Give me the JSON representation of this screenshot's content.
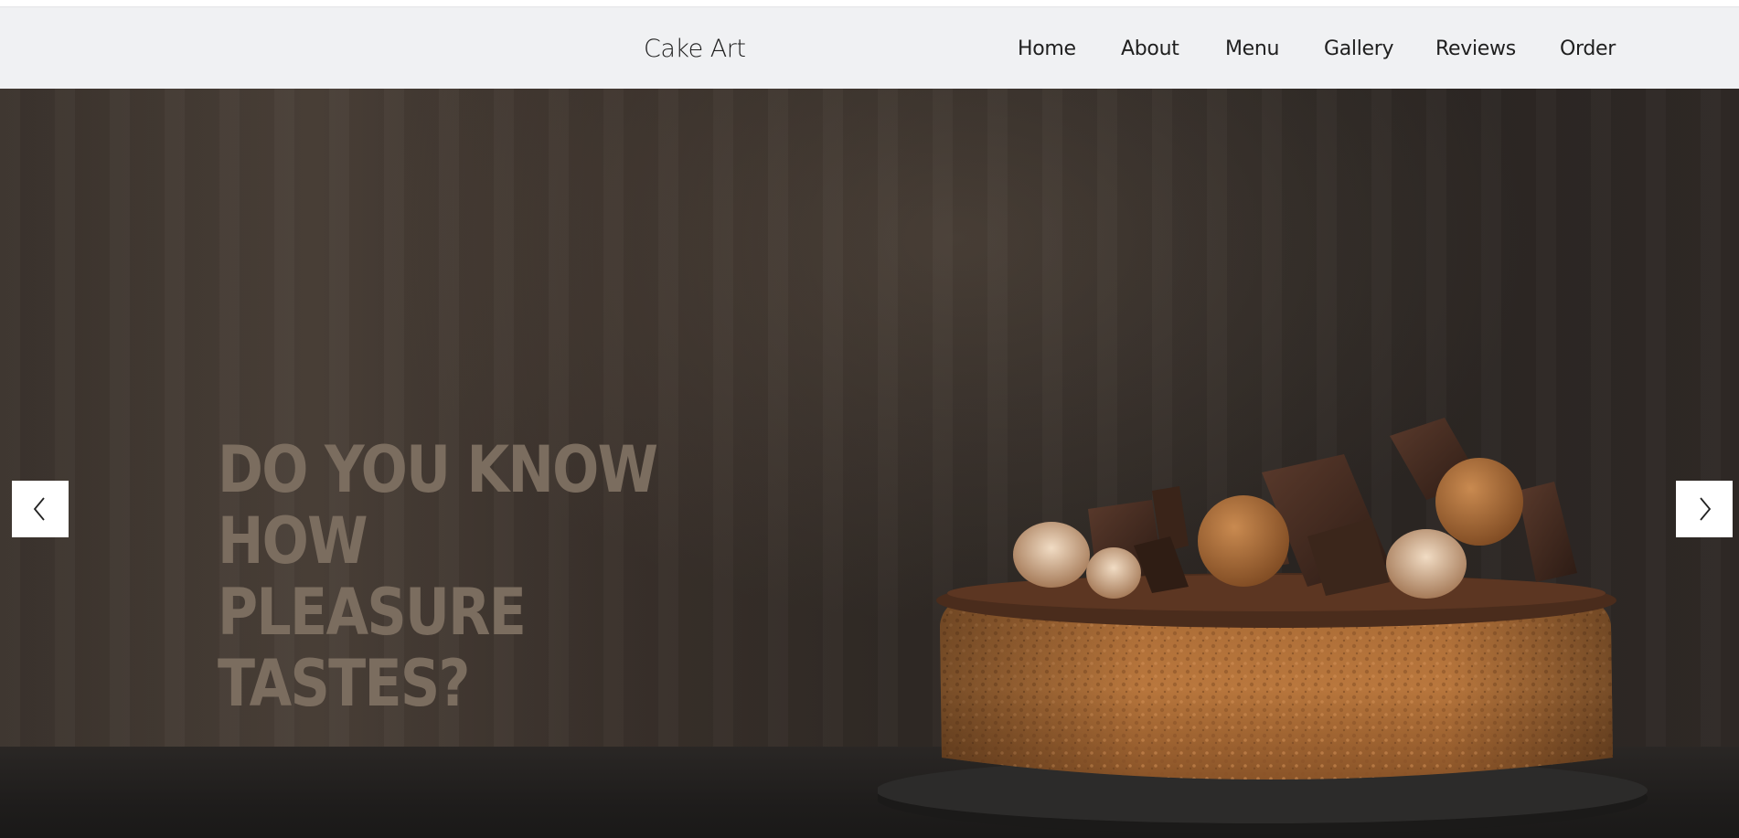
{
  "brand": {
    "name": "Cake Art"
  },
  "nav": {
    "items": [
      {
        "label": "Home"
      },
      {
        "label": "About"
      },
      {
        "label": "Menu"
      },
      {
        "label": "Gallery"
      },
      {
        "label": "Reviews"
      },
      {
        "label": "Order"
      }
    ]
  },
  "hero": {
    "heading_line1": "DO YOU KNOW HOW",
    "heading_line2": "PLEASURE TASTES?",
    "heading_color": "#7b6d5f",
    "image_subject": "chocolate-cake-photo"
  },
  "carousel": {
    "prev_icon": "chevron-left-icon",
    "next_icon": "chevron-right-icon"
  },
  "colors": {
    "navbar_bg": "#f0f1f3",
    "text": "#1f1f1f"
  }
}
